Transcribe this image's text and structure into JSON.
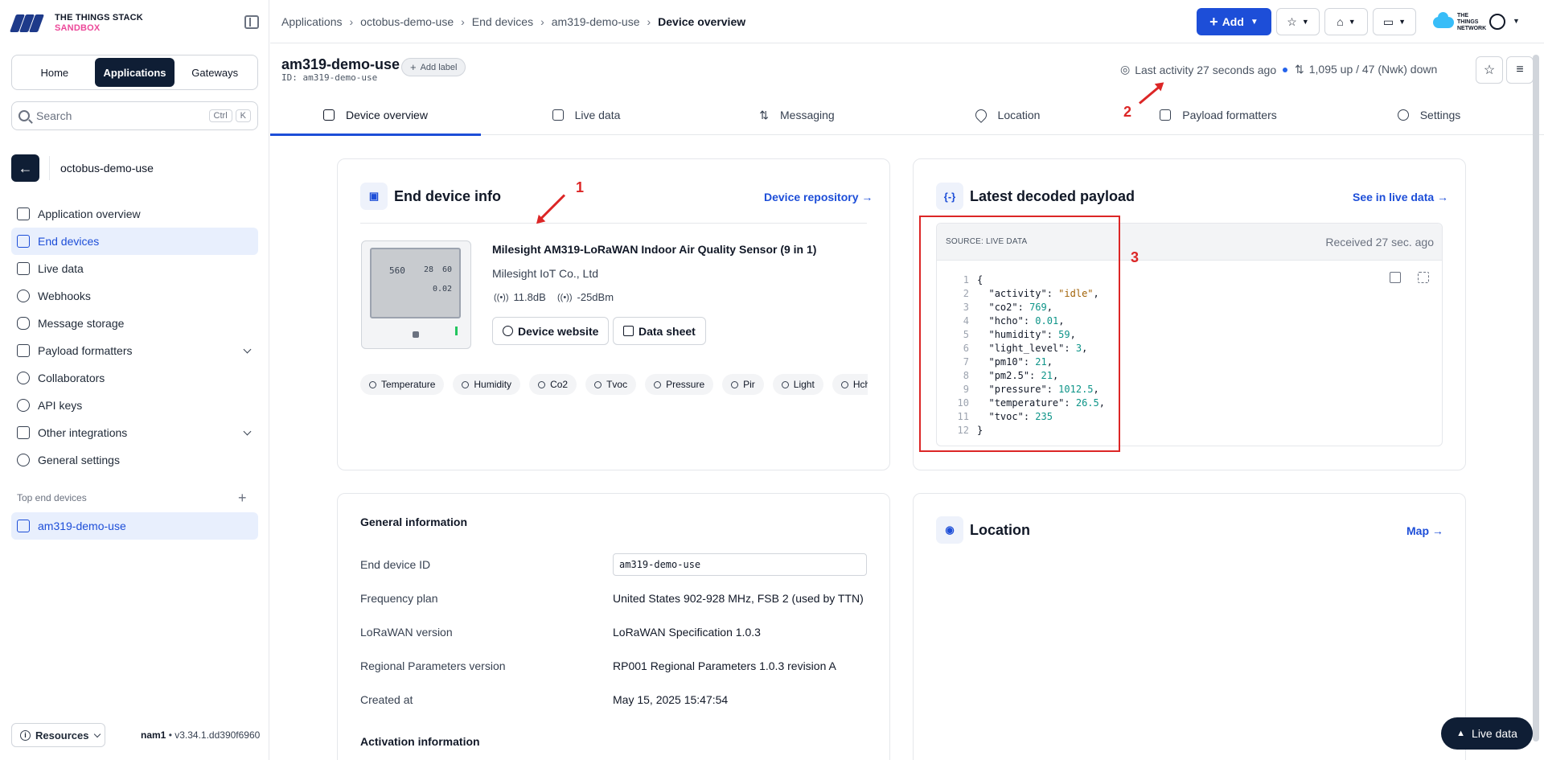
{
  "brand": {
    "line1": "THE THINGS STACK",
    "line2": "SANDBOX"
  },
  "segment": [
    "Home",
    "Applications",
    "Gateways"
  ],
  "search": {
    "placeholder": "Search",
    "kbd1": "Ctrl",
    "kbd2": "K"
  },
  "app": {
    "name": "octobus-demo-use"
  },
  "nav": [
    "Application overview",
    "End devices",
    "Live data",
    "Webhooks",
    "Message storage",
    "Payload formatters",
    "Collaborators",
    "API keys",
    "Other integrations",
    "General settings"
  ],
  "top_devices": {
    "title": "Top end devices",
    "item": "am319-demo-use"
  },
  "footer": {
    "resources": "Resources",
    "cluster": "nam1",
    "version": " • v3.34.1.dd390f6960"
  },
  "breadcrumb": [
    "Applications",
    "octobus-demo-use",
    "End devices",
    "am319-demo-use",
    "Device overview"
  ],
  "topbar": {
    "add": "Add",
    "ttn": "THE THINGS NETWORK"
  },
  "device": {
    "title": "am319-demo-use",
    "id": "ID: am319-demo-use",
    "add_label": "Add label",
    "last_activity": "Last activity 27 seconds ago",
    "traffic": "1,095 up / 47 (Nwk) down"
  },
  "tabs": [
    "Device overview",
    "Live data",
    "Messaging",
    "Location",
    "Payload formatters",
    "Settings"
  ],
  "info_card": {
    "title": "End device info",
    "link": "Device repository →",
    "name": "Milesight AM319-LoRaWAN Indoor Air Quality Sensor (9 in 1)",
    "vendor": "Milesight IoT Co., Ltd",
    "snr": "11.8dB",
    "rssi": "-25dBm",
    "website": "Device website",
    "datasheet": "Data sheet",
    "chips": [
      "Temperature",
      "Humidity",
      "Co2",
      "Tvoc",
      "Pressure",
      "Pir",
      "Light",
      "Hcho"
    ],
    "screen": {
      "a": "560",
      "b": "28",
      "c": "60",
      "d": "0.02"
    }
  },
  "payload_card": {
    "title": "Latest decoded payload",
    "link": "See in live data →",
    "source": "SOURCE: LIVE DATA",
    "received": "Received 27 sec. ago",
    "fields": [
      {
        "key": "activity",
        "value": "\"idle\"",
        "type": "s"
      },
      {
        "key": "co2",
        "value": "769",
        "type": "n"
      },
      {
        "key": "hcho",
        "value": "0.01",
        "type": "n"
      },
      {
        "key": "humidity",
        "value": "59",
        "type": "n"
      },
      {
        "key": "light_level",
        "value": "3",
        "type": "n"
      },
      {
        "key": "pm10",
        "value": "21",
        "type": "n"
      },
      {
        "key": "pm2.5",
        "value": "21",
        "type": "n"
      },
      {
        "key": "pressure",
        "value": "1012.5",
        "type": "n"
      },
      {
        "key": "temperature",
        "value": "26.5",
        "type": "n"
      },
      {
        "key": "tvoc",
        "value": "235",
        "type": "n"
      }
    ]
  },
  "annotations": [
    "1",
    "2",
    "3"
  ],
  "general": {
    "title": "General information",
    "rows": [
      {
        "label": "End device ID",
        "value": "am319-demo-use"
      },
      {
        "label": "Frequency plan",
        "value": "United States 902-928 MHz, FSB 2 (used by TTN)"
      },
      {
        "label": "LoRaWAN version",
        "value": "LoRaWAN Specification 1.0.3"
      },
      {
        "label": "Regional Parameters version",
        "value": "RP001 Regional Parameters 1.0.3 revision A"
      },
      {
        "label": "Created at",
        "value": "May 15, 2025 15:47:54"
      }
    ],
    "activation_title": "Activation information"
  },
  "location_card": {
    "title": "Location",
    "link": "Map →"
  },
  "live_data_button": "Live data"
}
